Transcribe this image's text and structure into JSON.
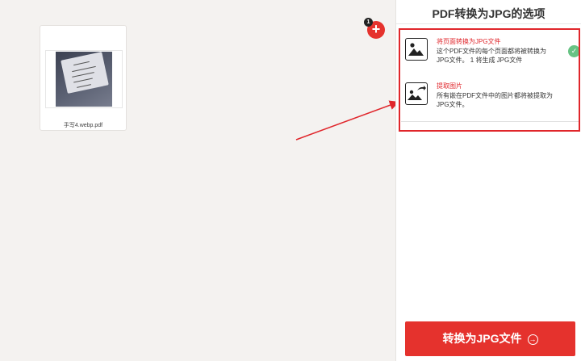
{
  "file": {
    "name": "手写4.webp.pdf"
  },
  "workspace": {
    "add_label": "+",
    "add_count": "1"
  },
  "panel": {
    "title": "PDF转换为JPG的选项",
    "options": [
      {
        "title": "将页面转换为JPG文件",
        "desc": "这个PDF文件的每个页面都将被转换为JPG文件。 1 将生成 JPG文件",
        "selected": true,
        "icon": "image-icon"
      },
      {
        "title": "提取图片",
        "desc": "所有嵌在PDF文件中的图片都将被提取为JPG文件。",
        "selected": false,
        "icon": "image-export-icon"
      }
    ],
    "check_glyph": "✓"
  },
  "convert": {
    "label": "转换为JPG文件",
    "arrow_glyph": "→"
  },
  "colors": {
    "accent": "#e5322d",
    "highlight_border": "#e0262b",
    "check": "#67c384"
  }
}
